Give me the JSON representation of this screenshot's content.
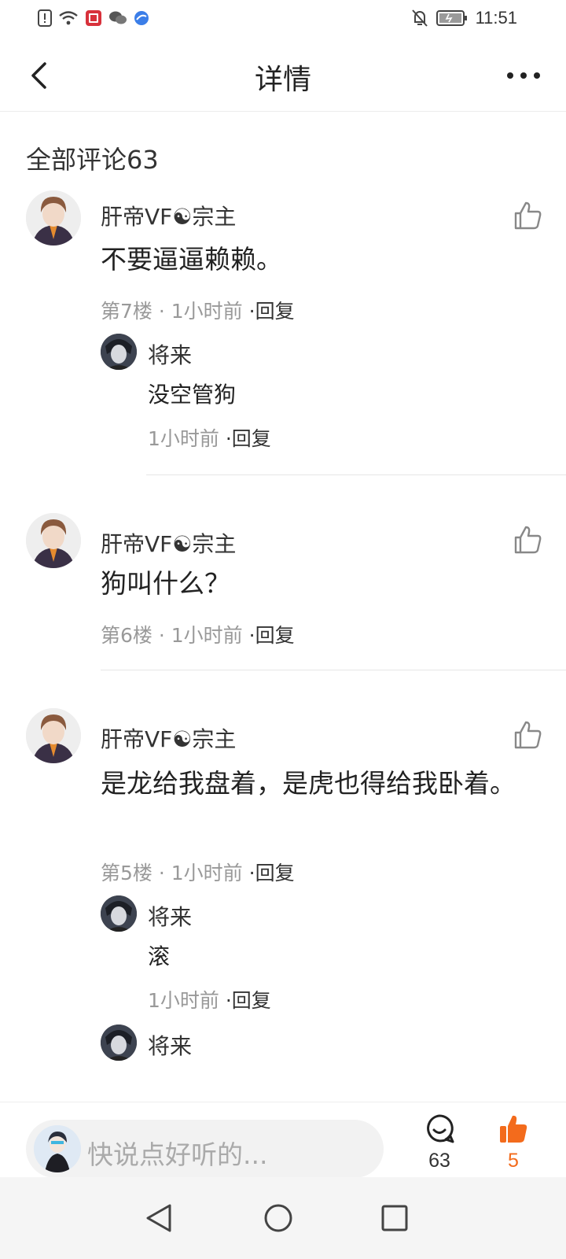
{
  "status_bar": {
    "time": "11:51"
  },
  "header": {
    "title": "详情"
  },
  "comments_section": {
    "title": "全部评论63"
  },
  "comments": [
    {
      "username": "肝帝VF☯宗主",
      "text": "不要逼逼赖赖。",
      "floor": "第7楼",
      "time": "1小时前",
      "reply_label": "·回复",
      "replies": [
        {
          "username": "将来",
          "text": "没空管狗",
          "time": "1小时前",
          "reply_label": "·回复"
        }
      ]
    },
    {
      "username": "肝帝VF☯宗主",
      "text": "狗叫什么？",
      "floor": "第6楼",
      "time": "1小时前",
      "reply_label": "·回复",
      "replies": []
    },
    {
      "username": "肝帝VF☯宗主",
      "text": "是龙给我盘着，是虎也得给我卧着。",
      "floor": "第5楼",
      "time": "1小时前",
      "reply_label": "·回复",
      "replies": [
        {
          "username": "将来",
          "text": "滚",
          "time": "1小时前",
          "reply_label": "·回复"
        },
        {
          "username": "将来",
          "text": "",
          "time": "",
          "reply_label": ""
        }
      ]
    }
  ],
  "bottom_bar": {
    "input_placeholder": "快说点好听的...",
    "comment_count": "63",
    "like_count": "5",
    "like_color": "#f36b1c"
  },
  "icons": {
    "back": "back-arrow-icon",
    "more": "more-icon",
    "like": "thumbs-up-icon",
    "comment": "comment-bubble-icon"
  }
}
